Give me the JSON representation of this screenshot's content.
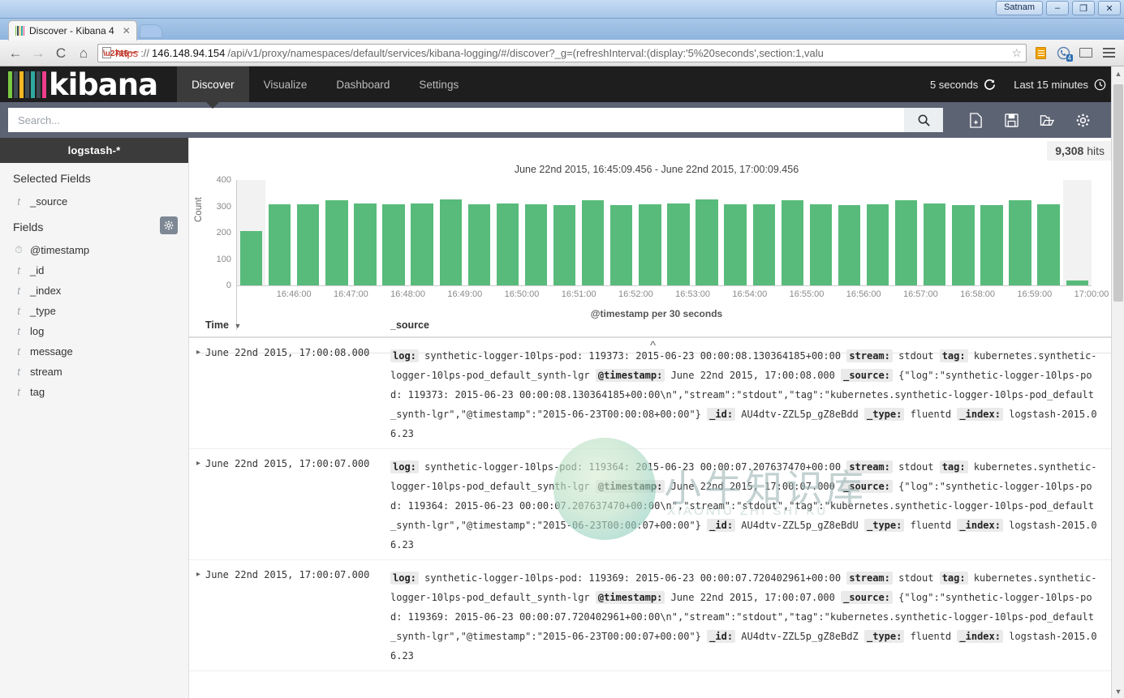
{
  "window": {
    "user_label": "Satnam",
    "minimize": "–",
    "maximize": "❐",
    "close": "✕"
  },
  "browser": {
    "tab": {
      "title": "Discover - Kibana 4",
      "close": "✕"
    },
    "nav": {
      "back": "←",
      "forward": "→",
      "reload": "C",
      "home": "⌂"
    },
    "url": {
      "scheme": "https",
      "separator": "://",
      "host": "146.148.94.154",
      "rest": "/api/v1/proxy/namespaces/default/services/kibana-logging/#/discover?_g=(refreshInterval:(display:'5%20seconds',section:1,valu",
      "bookmark_star": "☆"
    },
    "extension_badge": "4"
  },
  "kibana": {
    "logo_text": "kibana",
    "logo_bar_colors": [
      "#7ac943",
      "#3f4a54",
      "#f2b722",
      "#3f4a54",
      "#2fa8a0",
      "#3f4a54",
      "#ee3d8b"
    ],
    "tabs": [
      {
        "label": "Discover",
        "active": true
      },
      {
        "label": "Visualize",
        "active": false
      },
      {
        "label": "Dashboard",
        "active": false
      },
      {
        "label": "Settings",
        "active": false
      }
    ],
    "refresh_interval": "5 seconds",
    "refresh_icon": "refresh-icon",
    "time_range": "Last 15 minutes",
    "time_icon": "clock-icon",
    "search": {
      "value": "",
      "placeholder": "Search...",
      "go_icon": "search-icon"
    },
    "toolbar_icons": [
      {
        "name": "new-search-icon",
        "glyph": "📄"
      },
      {
        "name": "save-search-icon",
        "glyph": "💾"
      },
      {
        "name": "open-search-icon",
        "glyph": "📁"
      },
      {
        "name": "settings-gear-icon",
        "glyph": "⚙"
      }
    ]
  },
  "sidebar": {
    "index_pattern": "logstash-*",
    "selected_fields_label": "Selected Fields",
    "selected_fields": [
      {
        "type": "t",
        "name": "_source"
      }
    ],
    "fields_label": "Fields",
    "fields_gear_icon": "gear-icon",
    "fields": [
      {
        "type": "clock",
        "name": "@timestamp"
      },
      {
        "type": "t",
        "name": "_id"
      },
      {
        "type": "t",
        "name": "_index"
      },
      {
        "type": "t",
        "name": "_type"
      },
      {
        "type": "t",
        "name": "log"
      },
      {
        "type": "t",
        "name": "message"
      },
      {
        "type": "t",
        "name": "stream"
      },
      {
        "type": "t",
        "name": "tag"
      }
    ]
  },
  "main": {
    "hits_count": "9,308",
    "hits_label": "hits",
    "collapse_chevron": "^"
  },
  "chart_data": {
    "type": "bar",
    "title": "June 22nd 2015, 16:45:09.456 - June 22nd 2015, 17:00:09.456",
    "xlabel": "@timestamp per 30 seconds",
    "ylabel": "Count",
    "ylim": [
      0,
      400
    ],
    "yticks": [
      0,
      100,
      200,
      300,
      400
    ],
    "grid": false,
    "bar_color": "#58bb7b",
    "partial_bucket_highlight": "#f2f2f2",
    "x_tick_labels": [
      "16:46:00",
      "16:47:00",
      "16:48:00",
      "16:49:00",
      "16:50:00",
      "16:51:00",
      "16:52:00",
      "16:53:00",
      "16:54:00",
      "16:55:00",
      "16:56:00",
      "16:57:00",
      "16:58:00",
      "16:59:00",
      "17:00:00"
    ],
    "categories": [
      "16:45:30",
      "16:46:00",
      "16:46:30",
      "16:47:00",
      "16:47:30",
      "16:48:00",
      "16:48:30",
      "16:49:00",
      "16:49:30",
      "16:50:00",
      "16:50:30",
      "16:51:00",
      "16:51:30",
      "16:52:00",
      "16:52:30",
      "16:53:00",
      "16:53:30",
      "16:54:00",
      "16:54:30",
      "16:55:00",
      "16:55:30",
      "16:56:00",
      "16:56:30",
      "16:57:00",
      "16:57:30",
      "16:58:00",
      "16:58:30",
      "16:59:00",
      "16:59:30",
      "17:00:00"
    ],
    "values": [
      205,
      307,
      308,
      324,
      312,
      307,
      310,
      325,
      308,
      311,
      308,
      305,
      324,
      306,
      308,
      311,
      325,
      307,
      309,
      322,
      307,
      306,
      307,
      324,
      311,
      305,
      306,
      323,
      308,
      20
    ],
    "partial_buckets": [
      0,
      29
    ]
  },
  "watermark": {
    "text": "小牛知识库",
    "subtitle": "XIAONIU ZHI SHI KU"
  },
  "results": {
    "columns": {
      "time": "Time",
      "source": "_source"
    },
    "sort_caret": "▼",
    "expand_caret": "▸",
    "rows": [
      {
        "time": "June 22nd 2015, 17:00:08.000",
        "fields": [
          {
            "key": "log:",
            "value": "synthetic-logger-10lps-pod: 119373: 2015-06-23 00:00:08.130364185+00:00"
          },
          {
            "key": "stream:",
            "value": "stdout"
          },
          {
            "key": "tag:",
            "value": "kubernetes.synthetic-logger-10lps-pod_default_synth-lgr"
          },
          {
            "key": "@timestamp:",
            "value": "June 22nd 2015, 17:00:08.000"
          },
          {
            "key": "_source:",
            "value": "{\"log\":\"synthetic-logger-10lps-pod: 119373: 2015-06-23 00:00:08.130364185+00:00\\n\",\"stream\":\"stdout\",\"tag\":\"kubernetes.synthetic-logger-10lps-pod_default_synth-lgr\",\"@timestamp\":\"2015-06-23T00:00:08+00:00\"}"
          },
          {
            "key": "_id:",
            "value": "AU4dtv-ZZL5p_gZ8eBdd"
          },
          {
            "key": "_type:",
            "value": "fluentd"
          },
          {
            "key": "_index:",
            "value": "logstash-2015.06.23"
          }
        ]
      },
      {
        "time": "June 22nd 2015, 17:00:07.000",
        "fields": [
          {
            "key": "log:",
            "value": "synthetic-logger-10lps-pod: 119364: 2015-06-23 00:00:07.207637470+00:00"
          },
          {
            "key": "stream:",
            "value": "stdout"
          },
          {
            "key": "tag:",
            "value": "kubernetes.synthetic-logger-10lps-pod_default_synth-lgr"
          },
          {
            "key": "@timestamp:",
            "value": "June 22nd 2015, 17:00:07.000"
          },
          {
            "key": "_source:",
            "value": "{\"log\":\"synthetic-logger-10lps-pod: 119364: 2015-06-23 00:00:07.207637470+00:00\\n\",\"stream\":\"stdout\",\"tag\":\"kubernetes.synthetic-logger-10lps-pod_default_synth-lgr\",\"@timestamp\":\"2015-06-23T00:00:07+00:00\"}"
          },
          {
            "key": "_id:",
            "value": "AU4dtv-ZZL5p_gZ8eBdU"
          },
          {
            "key": "_type:",
            "value": "fluentd"
          },
          {
            "key": "_index:",
            "value": "logstash-2015.06.23"
          }
        ]
      },
      {
        "time": "June 22nd 2015, 17:00:07.000",
        "fields": [
          {
            "key": "log:",
            "value": "synthetic-logger-10lps-pod: 119369: 2015-06-23 00:00:07.720402961+00:00"
          },
          {
            "key": "stream:",
            "value": "stdout"
          },
          {
            "key": "tag:",
            "value": "kubernetes.synthetic-logger-10lps-pod_default_synth-lgr"
          },
          {
            "key": "@timestamp:",
            "value": "June 22nd 2015, 17:00:07.000"
          },
          {
            "key": "_source:",
            "value": "{\"log\":\"synthetic-logger-10lps-pod: 119369: 2015-06-23 00:00:07.720402961+00:00\\n\",\"stream\":\"stdout\",\"tag\":\"kubernetes.synthetic-logger-10lps-pod_default_synth-lgr\",\"@timestamp\":\"2015-06-23T00:00:07+00:00\"}"
          },
          {
            "key": "_id:",
            "value": "AU4dtv-ZZL5p_gZ8eBdZ"
          },
          {
            "key": "_type:",
            "value": "fluentd"
          },
          {
            "key": "_index:",
            "value": "logstash-2015.06.23"
          }
        ]
      }
    ]
  }
}
